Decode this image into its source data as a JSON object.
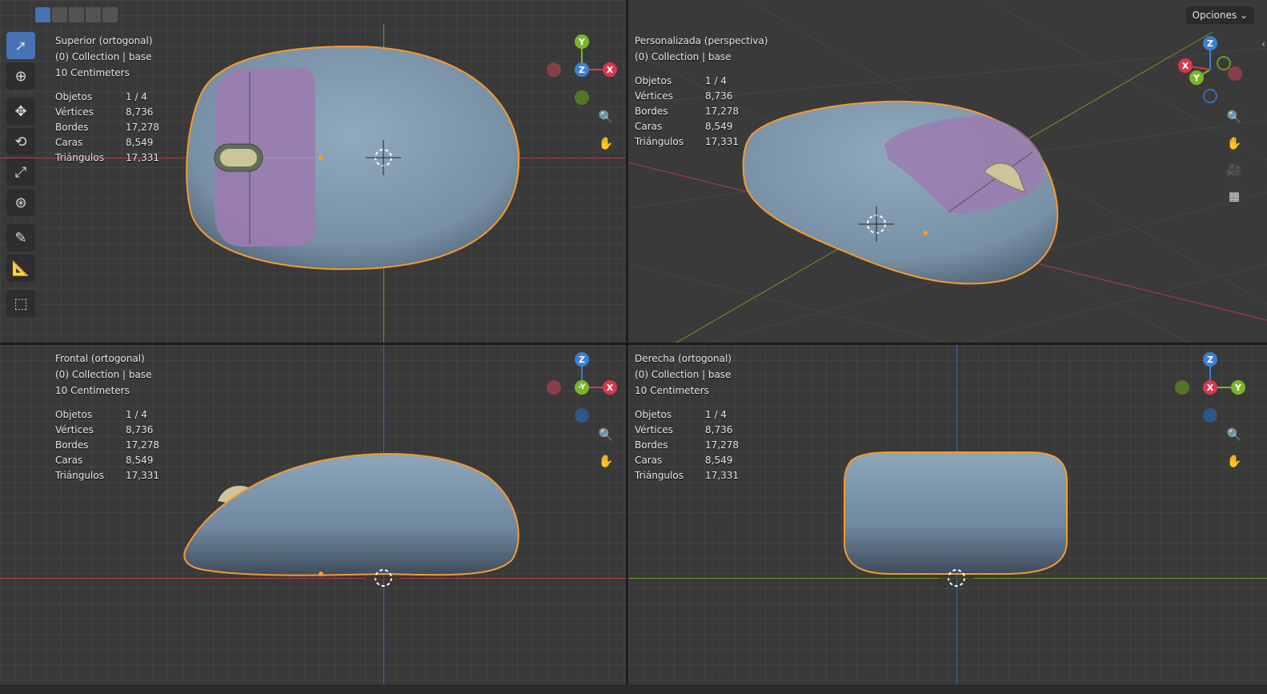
{
  "header": {
    "options_label": "Opciones",
    "options_chevron": "⌄",
    "select_modes": [
      "new",
      "extend",
      "subtract",
      "difference",
      "intersect"
    ]
  },
  "toolbar": {
    "tools": [
      {
        "name": "select-box-tool",
        "icon": "cursor-box-icon",
        "glyph": "➚"
      },
      {
        "name": "cursor-tool",
        "icon": "3d-cursor-icon",
        "glyph": "⊕"
      },
      {
        "name": "move-tool",
        "icon": "move-icon",
        "glyph": "✥"
      },
      {
        "name": "rotate-tool",
        "icon": "rotate-icon",
        "glyph": "⟲"
      },
      {
        "name": "scale-tool",
        "icon": "scale-icon",
        "glyph": "⤢"
      },
      {
        "name": "transform-tool",
        "icon": "transform-icon",
        "glyph": "⊛"
      },
      {
        "name": "annotate-tool",
        "icon": "pencil-icon",
        "glyph": "✎"
      },
      {
        "name": "measure-tool",
        "icon": "ruler-icon",
        "glyph": "📐"
      },
      {
        "name": "add-cube-tool",
        "icon": "add-cube-icon",
        "glyph": "⬚"
      }
    ]
  },
  "stats_labels": {
    "objects": "Objetos",
    "vertices": "Vértices",
    "edges": "Bordes",
    "faces": "Caras",
    "triangles": "Triángulos"
  },
  "stats_values": {
    "objects": "1 / 4",
    "vertices": "8,736",
    "edges": "17,278",
    "faces": "8,549",
    "triangles": "17,331"
  },
  "viewports": {
    "top": {
      "title": "Superior (ortogonal)",
      "collection": "(0) Collection | base",
      "scale": "10 Centimeters",
      "gizmo": {
        "up": "Y",
        "center": "Z",
        "right": "X"
      }
    },
    "persp": {
      "title": "Personalizada (perspectiva)",
      "collection": "(0) Collection | base",
      "gizmo": {
        "z": "Z",
        "y": "Y",
        "x": "X"
      }
    },
    "front": {
      "title": "Frontal (ortogonal)",
      "collection": "(0) Collection | base",
      "scale": "10 Centimeters",
      "gizmo": {
        "up": "Z",
        "center": "-Y",
        "right": "X"
      }
    },
    "right": {
      "title": "Derecha (ortogonal)",
      "collection": "(0) Collection | base",
      "scale": "10 Centimeters",
      "gizmo": {
        "up": "Z",
        "center": "X",
        "right": "Y"
      }
    }
  },
  "nav_icons": {
    "zoom": "🔍",
    "pan": "✋",
    "camera": "🎥",
    "grid": "▦"
  },
  "colors": {
    "x_axis": "#d8384f",
    "y_axis": "#7bb62a",
    "z_axis": "#3d7ed8",
    "selection": "#f59a2e",
    "mesh": "#7f98ad",
    "button_area": "#9b7cb0",
    "accent": "#4772b3"
  }
}
